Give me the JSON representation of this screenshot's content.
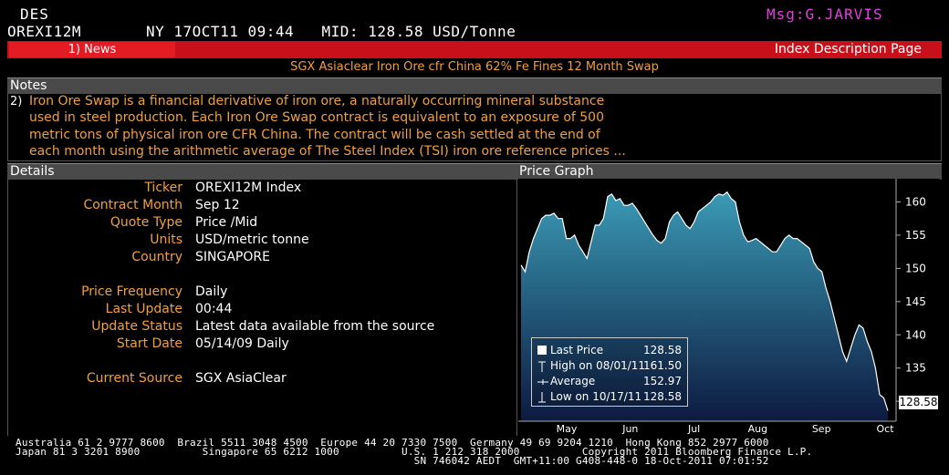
{
  "header": {
    "command": "DES",
    "message": "Msg:G.JARVIS",
    "ticker": "OREXI12M",
    "location_time": "NY 17OCT11 09:44",
    "mid_label": "MID: 128.58 USD/Tonne"
  },
  "toolbar": {
    "news_tab": "1) News",
    "page_title": "Index Description Page"
  },
  "subtitle": "SGX Asiaclear Iron Ore cfr China 62% Fe Fines 12 Month Swap",
  "notes": {
    "header": "Notes",
    "number": "2)",
    "lines": [
      "Iron Ore Swap is a financial derivative of iron ore, a naturally occurring mineral substance",
      "used in steel production. Each Iron Ore Swap contract is equivalent to an exposure of 500",
      "metric tons of physical iron ore CFR China. The contract will be cash settled at the end of",
      "each month using the arithmetic average of The Steel Index (TSI) iron ore reference prices ..."
    ]
  },
  "details": {
    "header": "Details",
    "rows": [
      {
        "label": "Ticker",
        "value": "OREXI12M  Index"
      },
      {
        "label": "Contract Month",
        "value": "Sep 12"
      },
      {
        "label": "Quote Type",
        "value": "Price /Mid"
      },
      {
        "label": "Units",
        "value": "USD/metric tonne"
      },
      {
        "label": "Country",
        "value": "SINGAPORE"
      },
      {
        "label": "Price Frequency",
        "value": "Daily"
      },
      {
        "label": "Last Update",
        "value": "00:44"
      },
      {
        "label": "Update Status",
        "value": "Latest data available from the source"
      },
      {
        "label": "Start Date",
        "value": "05/14/09 Daily"
      },
      {
        "label": "Current Source",
        "value": "SGX AsiaClear"
      }
    ]
  },
  "price_graph": {
    "header": "Price Graph",
    "last_price_tag": "128.58",
    "legend": [
      {
        "icon": "last-price-icon",
        "name": "Last Price",
        "value": "128.58"
      },
      {
        "icon": "high-icon",
        "name": "High on 08/01/11",
        "value": "161.50"
      },
      {
        "icon": "average-icon",
        "name": "Average",
        "value": "152.97"
      },
      {
        "icon": "low-icon",
        "name": "Low on 10/17/11",
        "value": "128.58"
      }
    ]
  },
  "chart_data": {
    "type": "area",
    "x_tick_labels": [
      "May",
      "Jun",
      "Jul",
      "Aug",
      "Sep",
      "Oct"
    ],
    "y_ticks": [
      130,
      135,
      140,
      145,
      150,
      155,
      160
    ],
    "ylim": [
      127,
      163.5
    ],
    "grid": false,
    "legend_position": "bottom-left",
    "colors": {
      "fill_top": "#3a9ab5",
      "fill_bottom": "#0d1a40",
      "line": "#ffffff",
      "background": "#000000"
    },
    "series": [
      {
        "name": "Last Price",
        "values": [
          150.5,
          149.5,
          152.5,
          154.5,
          156,
          157.5,
          158,
          158,
          158.3,
          157.5,
          157.5,
          154.5,
          154.5,
          155,
          153.5,
          152.5,
          151.5,
          154,
          156.5,
          156.5,
          157.5,
          160.8,
          161.2,
          160.2,
          160.5,
          159.5,
          159.5,
          159.8,
          159,
          158,
          157,
          156,
          155,
          154.2,
          153.8,
          154.5,
          157,
          158,
          158.5,
          157.5,
          156.5,
          156,
          157,
          158.5,
          159,
          159.5,
          160,
          160.8,
          161.2,
          161,
          161.5,
          160.5,
          160,
          157,
          155,
          154,
          154.2,
          154.5,
          154,
          153.5,
          153,
          152.5,
          152.5,
          153.5,
          154.5,
          155,
          154.5,
          154.5,
          154,
          153.5,
          153,
          151,
          150,
          149.5,
          147,
          145,
          142.5,
          140,
          137.5,
          136,
          138,
          140,
          141.5,
          141,
          139,
          137.5,
          135,
          131,
          130.5,
          128.58
        ]
      }
    ]
  }
}
